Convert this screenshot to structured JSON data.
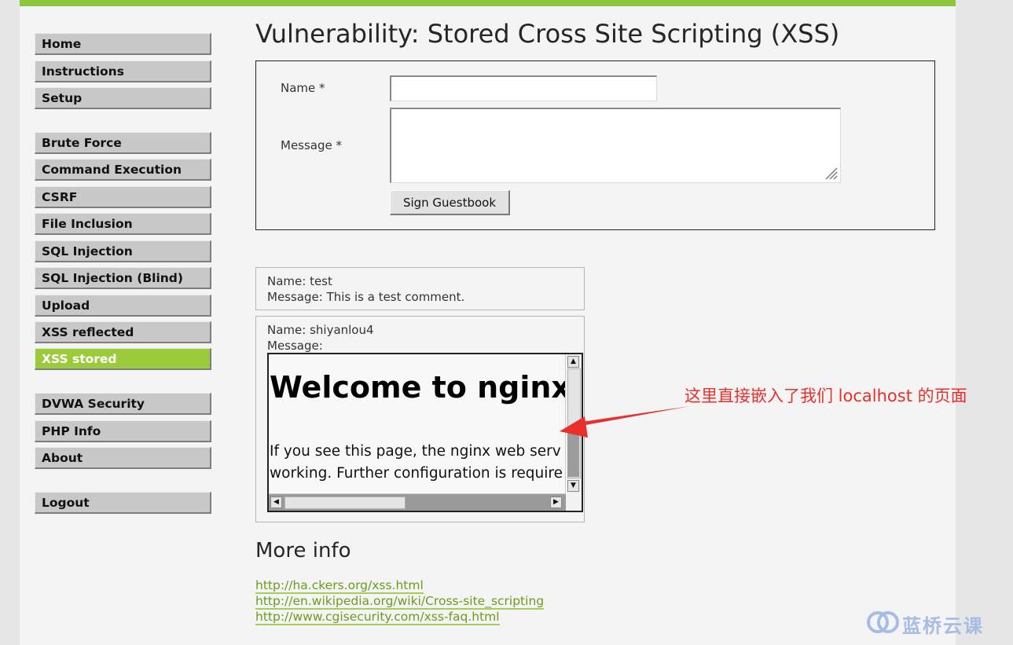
{
  "menu": {
    "groups": [
      [
        "Home",
        "Instructions",
        "Setup"
      ],
      [
        "Brute Force",
        "Command Execution",
        "CSRF",
        "File Inclusion",
        "SQL Injection",
        "SQL Injection (Blind)",
        "Upload",
        "XSS reflected",
        "XSS stored"
      ],
      [
        "DVWA Security",
        "PHP Info",
        "About"
      ],
      [
        "Logout"
      ]
    ],
    "selected": "XSS stored"
  },
  "title": "Vulnerability: Stored Cross Site Scripting (XSS)",
  "form": {
    "name_label": "Name *",
    "name_value": "",
    "message_label": "Message *",
    "message_value": "",
    "submit_label": "Sign Guestbook"
  },
  "comments": [
    {
      "name": "Name: test",
      "message": "Message: This is a test comment."
    },
    {
      "name": "Name: shiyanlou4",
      "message": "Message:"
    }
  ],
  "embedded_page": {
    "heading": "Welcome to nginx!",
    "para_line1": "If you see this page, the nginx web serv",
    "para_line2": "working. Further configuration is require"
  },
  "more_info": {
    "heading": "More info",
    "links": [
      "http://ha.ckers.org/xss.html",
      "http://en.wikipedia.org/wiki/Cross-site_scripting",
      "http://www.cgisecurity.com/xss-faq.html"
    ]
  },
  "annotation": {
    "text": "这里直接嵌入了我们 localhost 的页面",
    "color": "#e8302c"
  },
  "watermark": {
    "text": "蓝桥云课"
  },
  "colors": {
    "accent_green": "#8cc63f",
    "selected_menu": "#9bcb3b",
    "link": "#6c9b1e"
  }
}
